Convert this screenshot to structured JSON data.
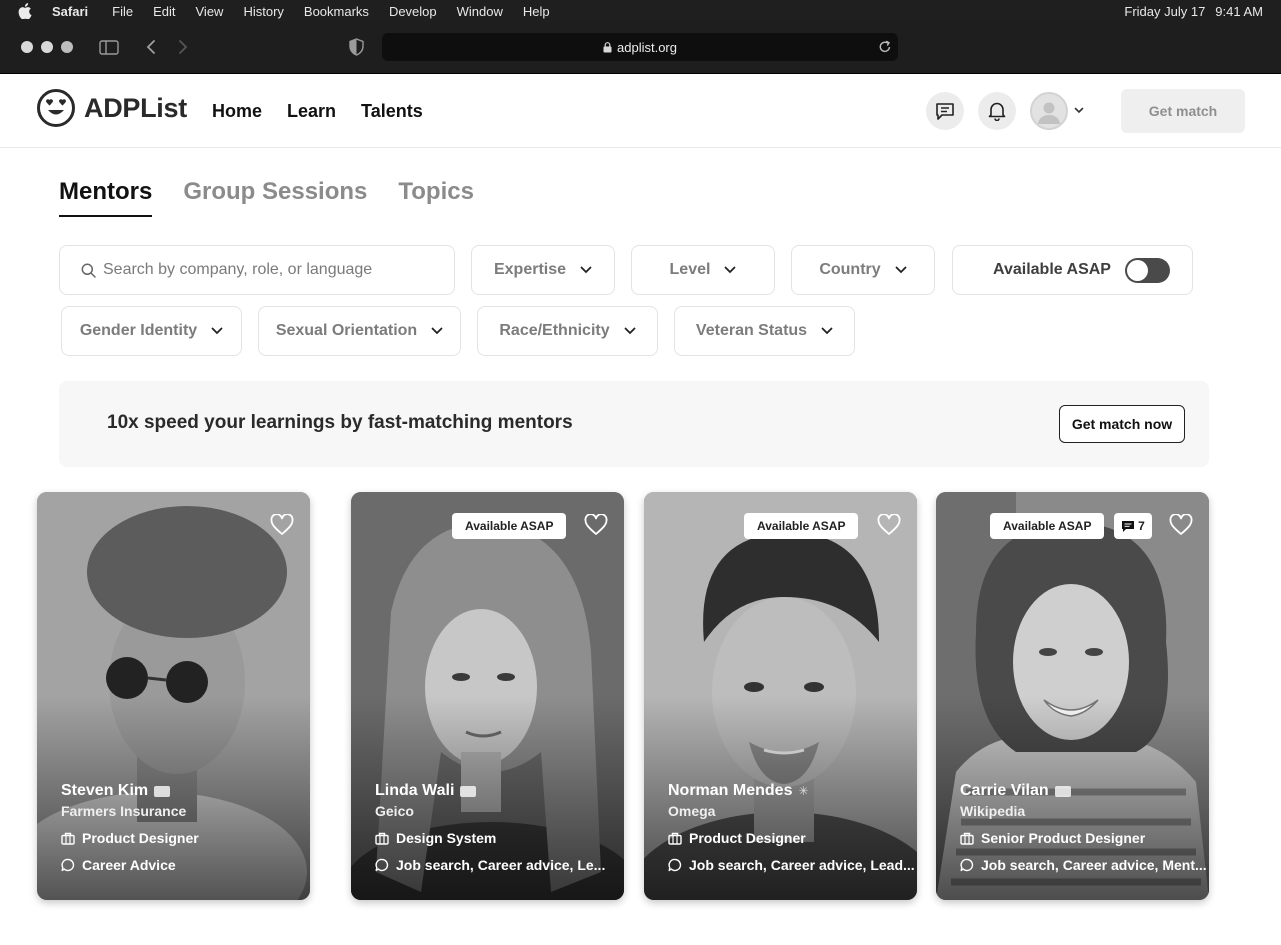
{
  "os_menubar": {
    "app_name": "Safari",
    "menus": [
      "File",
      "Edit",
      "View",
      "History",
      "Bookmarks",
      "Develop",
      "Window",
      "Help"
    ],
    "date": "Friday July 17",
    "time": "9:41 AM"
  },
  "browser": {
    "url": "adplist.org"
  },
  "site": {
    "logo_text": "ADPList",
    "nav": [
      "Home",
      "Learn",
      "Talents"
    ],
    "get_match_label": "Get match"
  },
  "tabs": [
    {
      "label": "Mentors",
      "active": true
    },
    {
      "label": "Group Sessions",
      "active": false
    },
    {
      "label": "Topics",
      "active": false
    }
  ],
  "filters": {
    "search_placeholder": "Search by company, role, or language",
    "row1": [
      "Expertise",
      "Level",
      "Country"
    ],
    "available_asap_label": "Available ASAP",
    "available_asap_on": false,
    "row2": [
      "Gender Identity",
      "Sexual Orientation",
      "Race/Ethnicity",
      "Veteran Status"
    ]
  },
  "banner": {
    "text": "10x speed your learnings by fast-matching mentors",
    "button_label": "Get match now"
  },
  "mentors": [
    {
      "name": "Steven Kim",
      "company": "Farmers Insurance",
      "role": "Product Designer",
      "topics": "Career Advice",
      "badge": "",
      "messages": ""
    },
    {
      "name": "Linda Wali",
      "company": "Geico",
      "role": "Design System",
      "topics": "Job search, Career advice, Le...",
      "badge": "Available ASAP",
      "messages": ""
    },
    {
      "name": "Norman Mendes",
      "company": "Omega",
      "role": "Product Designer",
      "topics": "Job search, Career advice, Lead...",
      "badge": "Available ASAP",
      "messages": ""
    },
    {
      "name": "Carrie Vilan",
      "company": "Wikipedia",
      "role": "Senior Product Designer",
      "topics": "Job search, Career advice, Ment...",
      "badge": "Available ASAP",
      "messages": "7"
    }
  ],
  "colors": {
    "text_primary": "#111111",
    "text_muted": "#8b8b8b",
    "border": "#e3e3e3",
    "toggle_off": "#4a4a4a"
  },
  "icons": [
    "apple-icon",
    "sidebar-icon",
    "back-icon",
    "forward-icon",
    "shield-icon",
    "lock-icon",
    "reload-icon",
    "logo-icon",
    "chat-icon",
    "bell-icon",
    "user-icon",
    "chevron-down-icon",
    "search-icon",
    "heart-icon",
    "briefcase-icon",
    "speech-bubble-icon"
  ]
}
